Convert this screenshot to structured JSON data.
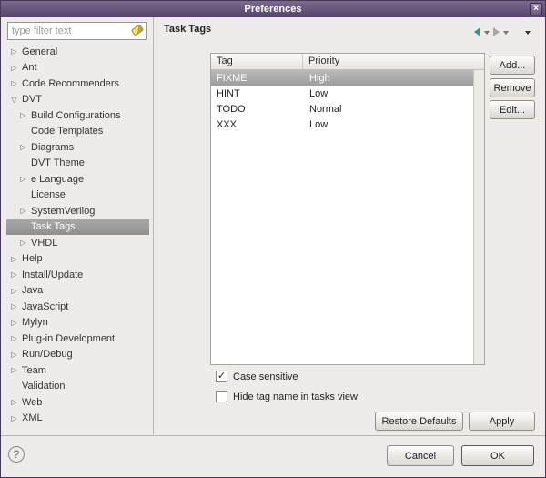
{
  "window": {
    "title": "Preferences"
  },
  "icons": {
    "close": "×",
    "help": "?",
    "check": "✓"
  },
  "sidebar": {
    "filter_placeholder": "type filter text",
    "items": [
      {
        "label": "General",
        "state": "collapsed",
        "indent": 0,
        "selected": false
      },
      {
        "label": "Ant",
        "state": "collapsed",
        "indent": 0,
        "selected": false
      },
      {
        "label": "Code Recommenders",
        "state": "collapsed",
        "indent": 0,
        "selected": false
      },
      {
        "label": "DVT",
        "state": "expanded",
        "indent": 0,
        "selected": false
      },
      {
        "label": "Build Configurations",
        "state": "collapsed",
        "indent": 1,
        "selected": false
      },
      {
        "label": "Code Templates",
        "state": "leaf",
        "indent": 1,
        "selected": false
      },
      {
        "label": "Diagrams",
        "state": "collapsed",
        "indent": 1,
        "selected": false
      },
      {
        "label": "DVT Theme",
        "state": "leaf",
        "indent": 1,
        "selected": false
      },
      {
        "label": "e Language",
        "state": "collapsed",
        "indent": 1,
        "selected": false
      },
      {
        "label": "License",
        "state": "leaf",
        "indent": 1,
        "selected": false
      },
      {
        "label": "SystemVerilog",
        "state": "collapsed",
        "indent": 1,
        "selected": false
      },
      {
        "label": "Task Tags",
        "state": "leaf",
        "indent": 1,
        "selected": true
      },
      {
        "label": "VHDL",
        "state": "collapsed",
        "indent": 1,
        "selected": false
      },
      {
        "label": "Help",
        "state": "collapsed",
        "indent": 0,
        "selected": false
      },
      {
        "label": "Install/Update",
        "state": "collapsed",
        "indent": 0,
        "selected": false
      },
      {
        "label": "Java",
        "state": "collapsed",
        "indent": 0,
        "selected": false
      },
      {
        "label": "JavaScript",
        "state": "collapsed",
        "indent": 0,
        "selected": false
      },
      {
        "label": "Mylyn",
        "state": "collapsed",
        "indent": 0,
        "selected": false
      },
      {
        "label": "Plug-in Development",
        "state": "collapsed",
        "indent": 0,
        "selected": false
      },
      {
        "label": "Run/Debug",
        "state": "collapsed",
        "indent": 0,
        "selected": false
      },
      {
        "label": "Team",
        "state": "collapsed",
        "indent": 0,
        "selected": false
      },
      {
        "label": "Validation",
        "state": "leaf",
        "indent": 0,
        "selected": false
      },
      {
        "label": "Web",
        "state": "collapsed",
        "indent": 0,
        "selected": false
      },
      {
        "label": "XML",
        "state": "collapsed",
        "indent": 0,
        "selected": false
      }
    ]
  },
  "main": {
    "title": "Task Tags",
    "table": {
      "columns": [
        "Tag",
        "Priority"
      ],
      "rows": [
        {
          "tag": "FIXME",
          "priority": "High",
          "selected": true
        },
        {
          "tag": "HINT",
          "priority": "Low",
          "selected": false
        },
        {
          "tag": "TODO",
          "priority": "Normal",
          "selected": false
        },
        {
          "tag": "XXX",
          "priority": "Low",
          "selected": false
        }
      ]
    },
    "buttons": {
      "add": "Add...",
      "remove": "Remove",
      "edit": "Edit..."
    },
    "checkboxes": [
      {
        "label": "Case sensitive",
        "checked": true
      },
      {
        "label": "Hide tag name in tasks view",
        "checked": false
      }
    ],
    "footer_buttons": {
      "restore": "Restore Defaults",
      "apply": "Apply"
    }
  },
  "footer": {
    "cancel": "Cancel",
    "ok": "OK"
  }
}
